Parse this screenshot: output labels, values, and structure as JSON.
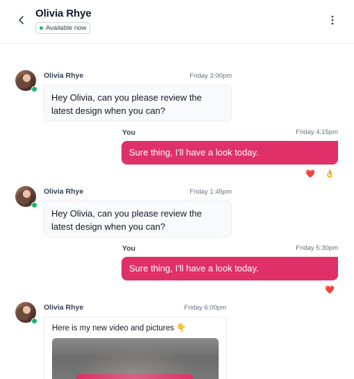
{
  "header": {
    "title": "Olivia Rhye",
    "status": "Available now"
  },
  "messages": [
    {
      "sender": "Olivia Rhye",
      "time": "Friday 3:00pm",
      "text": "Hey Olivia, can you please review the latest design when you can?"
    },
    {
      "sender": "You",
      "time": "Friday 4:15pm",
      "text": "Sure thing, I'll have a look today.",
      "reactions": [
        "❤️",
        "👌"
      ]
    },
    {
      "sender": "Olivia Rhye",
      "time": "Friday 1:45pm",
      "text": "Hey Olivia, can you please review the latest design when you can?"
    },
    {
      "sender": "You",
      "time": "Friday 5:30pm",
      "text": "Sure thing, I'll have a look today.",
      "reactions": [
        "❤️"
      ]
    },
    {
      "sender": "Olivia Rhye",
      "time": "Friday 6:00pm",
      "text": "Here is my new video and pictures 👇"
    }
  ],
  "colors": {
    "accent": "#e0306a",
    "online": "#12b76a"
  },
  "icons": {
    "back": "chevron-left-icon",
    "more": "more-vertical-icon"
  }
}
